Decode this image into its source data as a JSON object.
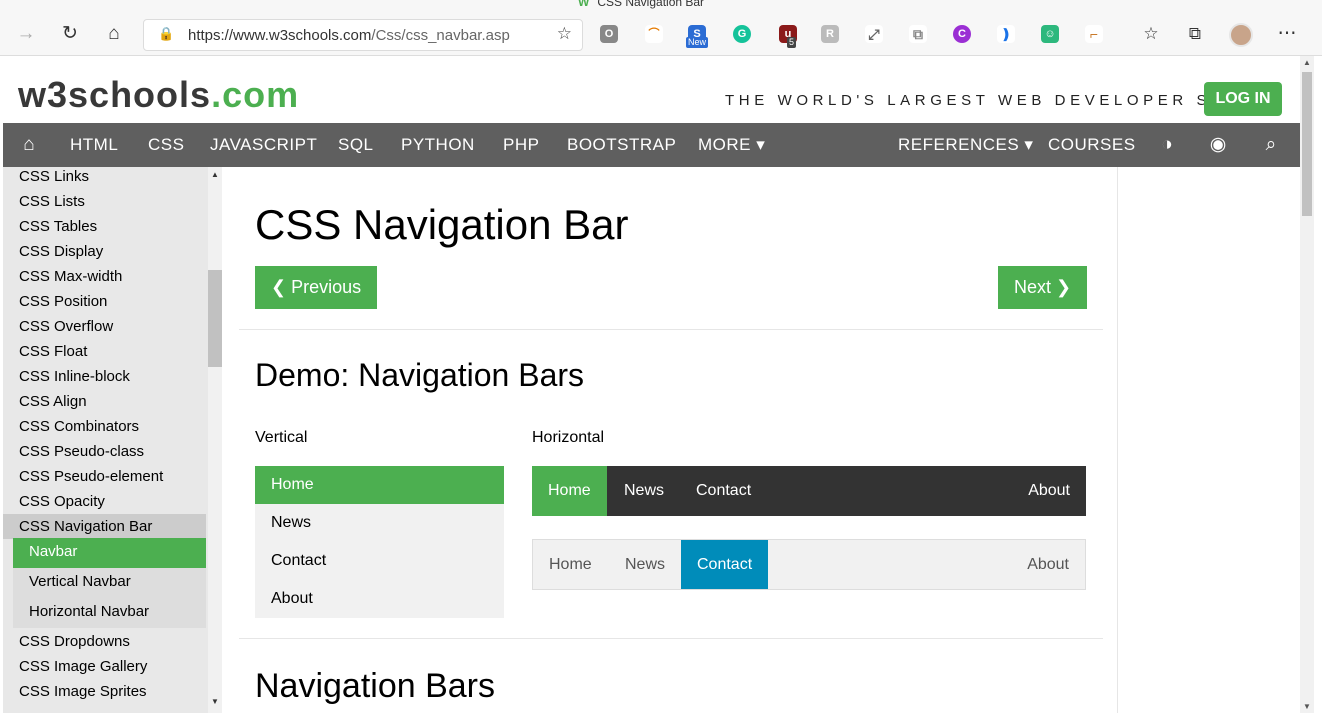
{
  "browser": {
    "window_title": "CSS Navigation Bar",
    "url_host": "https://www.w3schools.com",
    "url_path": "/Css/css_navbar.asp",
    "extension_badges": {
      "new": "New",
      "count": "5"
    }
  },
  "site": {
    "logo_main": "w3schools",
    "logo_suffix": ".com",
    "tagline": "THE WORLD'S LARGEST WEB DEVELOPER SITE",
    "login": "LOG IN"
  },
  "topnav": {
    "items": [
      "HTML",
      "CSS",
      "JAVASCRIPT",
      "SQL",
      "PYTHON",
      "PHP",
      "BOOTSTRAP",
      "MORE ▾",
      "REFERENCES ▾",
      "COURSES"
    ]
  },
  "sidebar": {
    "items": [
      "CSS Links",
      "CSS Lists",
      "CSS Tables",
      "CSS Display",
      "CSS Max-width",
      "CSS Position",
      "CSS Overflow",
      "CSS Float",
      "CSS Inline-block",
      "CSS Align",
      "CSS Combinators",
      "CSS Pseudo-class",
      "CSS Pseudo-element",
      "CSS Opacity",
      "CSS Navigation Bar"
    ],
    "sub_items": [
      "Navbar",
      "Vertical Navbar",
      "Horizontal Navbar"
    ],
    "after_items": [
      "CSS Dropdowns",
      "CSS Image Gallery",
      "CSS Image Sprites"
    ]
  },
  "main": {
    "title": "CSS Navigation Bar",
    "prev": "❮ Previous",
    "next": "Next ❯",
    "demo_heading": "Demo: Navigation Bars",
    "vertical_label": "Vertical",
    "horizontal_label": "Horizontal",
    "vertical_items": [
      "Home",
      "News",
      "Contact",
      "About"
    ],
    "horizontal_items": [
      "Home",
      "News",
      "Contact",
      "About"
    ],
    "section_heading": "Navigation Bars"
  },
  "colors": {
    "green": "#4caf50",
    "blue": "#008cba",
    "dark": "#333333",
    "nav": "#5f5f5f"
  }
}
